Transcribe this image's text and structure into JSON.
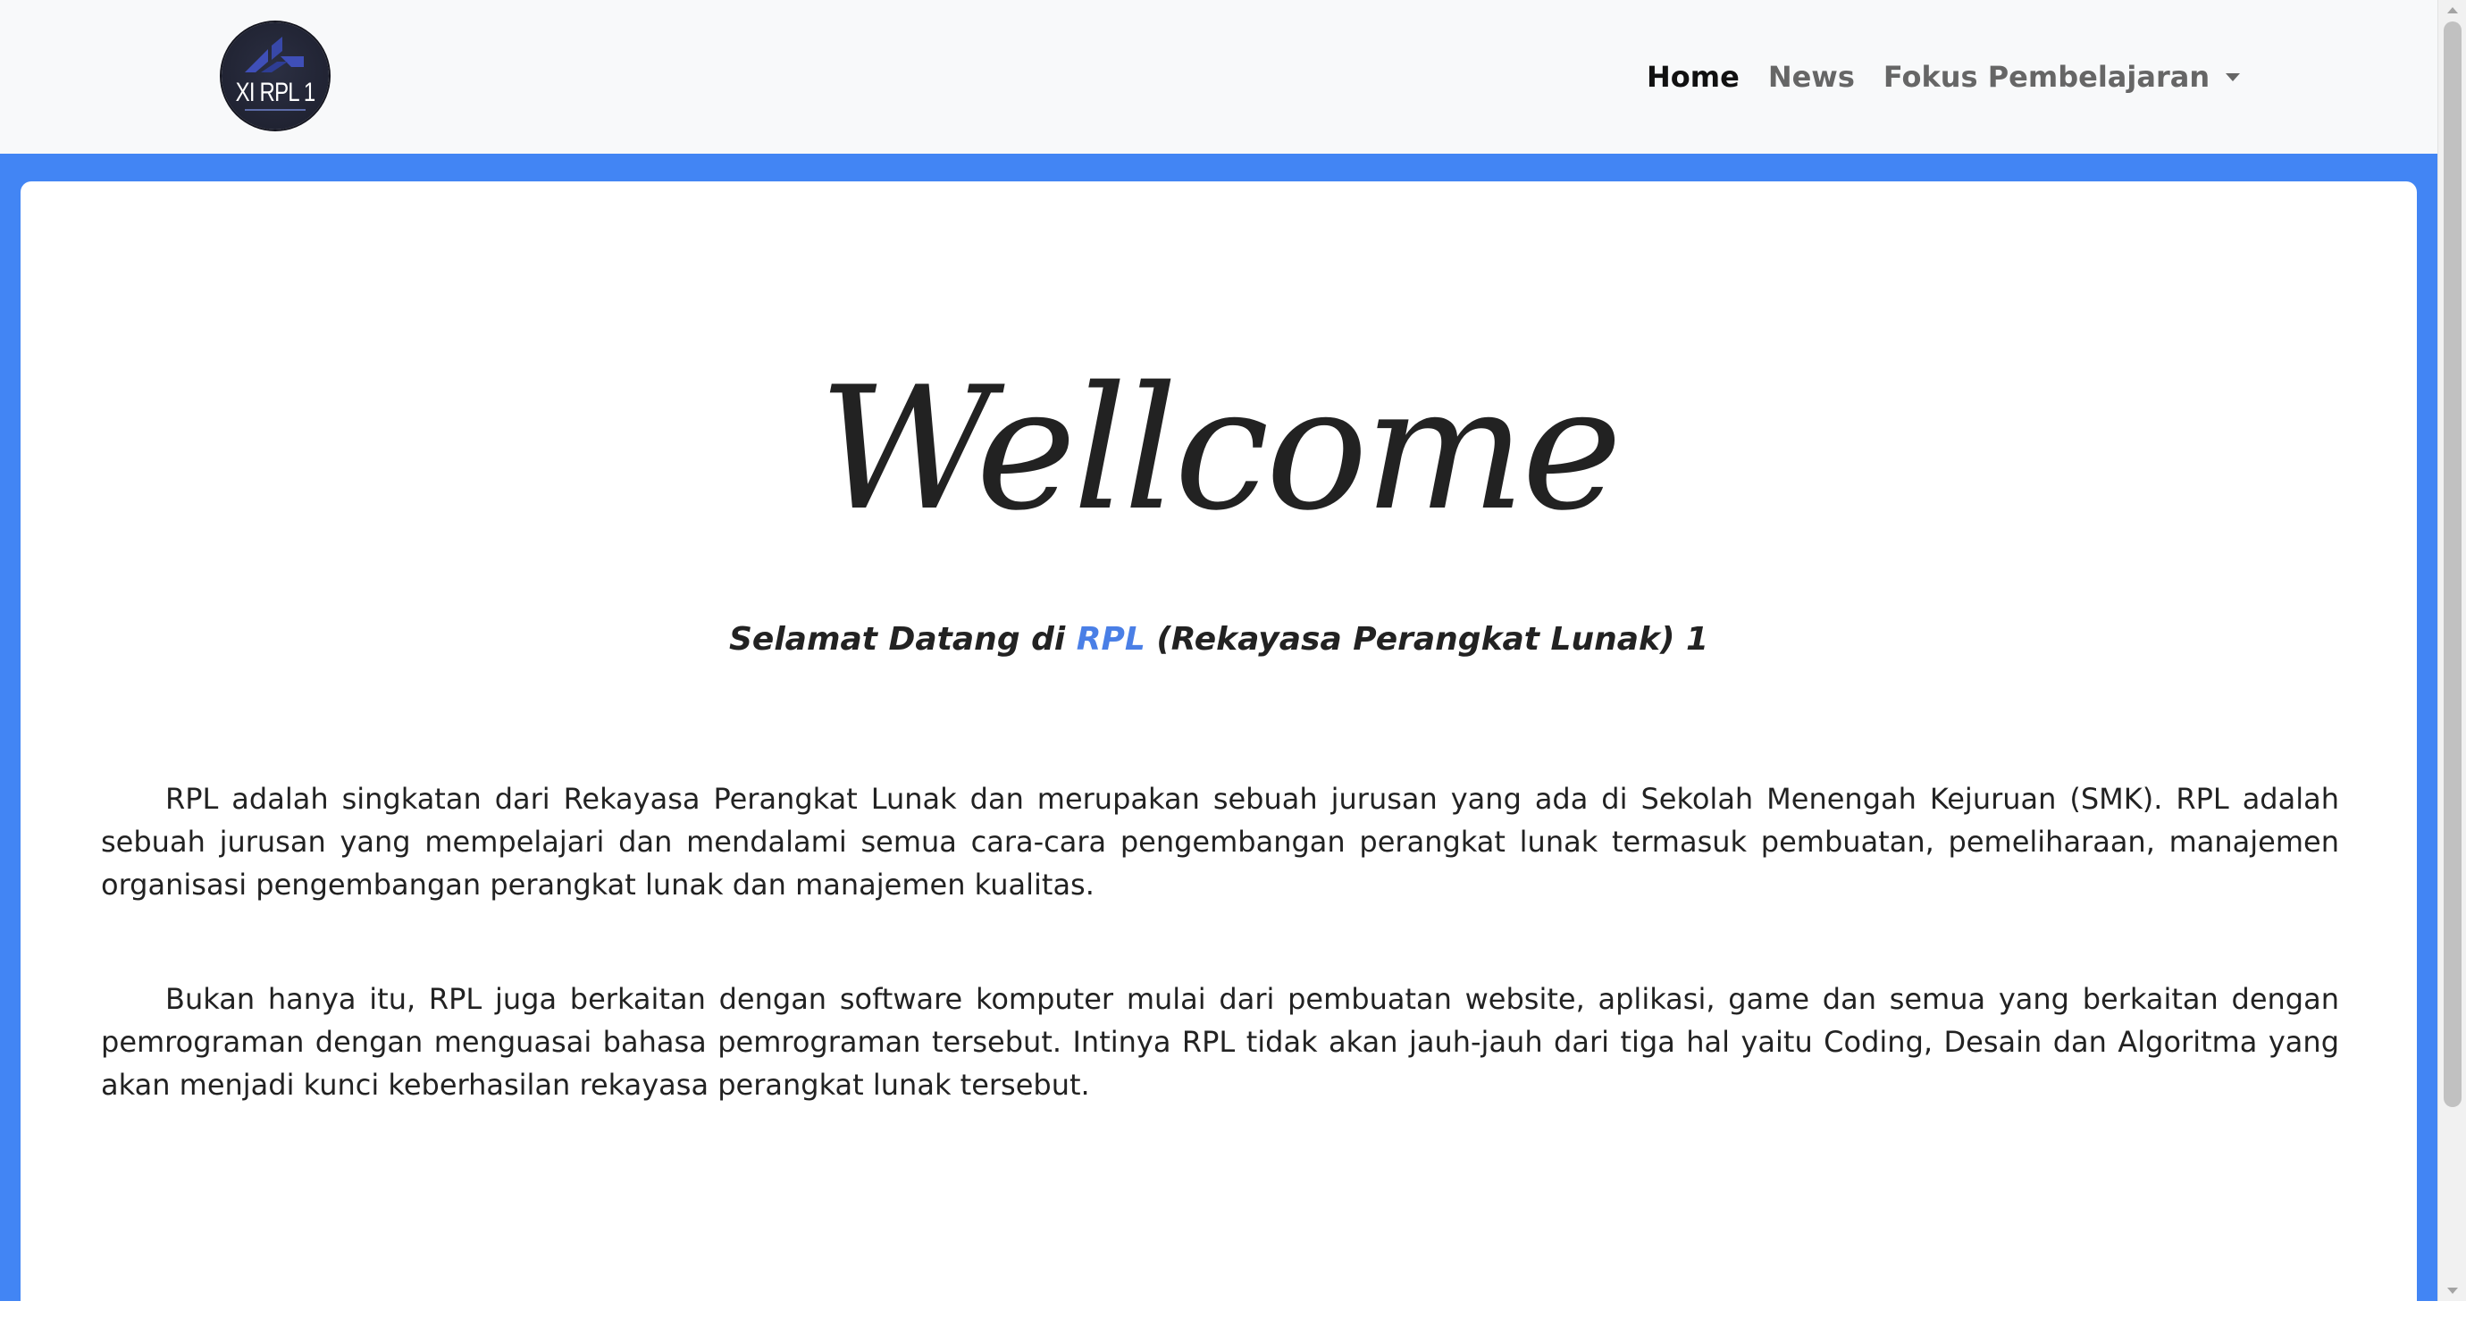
{
  "navbar": {
    "logo_text": "XI RPL 1",
    "links": [
      {
        "label": "Home",
        "active": true
      },
      {
        "label": "News",
        "active": false
      }
    ],
    "dropdown_label": "Fokus Pembelajaran"
  },
  "hero": {
    "title": "Wellcome",
    "subtitle_prefix": "Selamat Datang di ",
    "subtitle_accent": "RPL",
    "subtitle_suffix": " (Rekayasa Perangkat Lunak) 1"
  },
  "content": {
    "paragraph1": "RPL adalah singkatan dari Rekayasa Perangkat Lunak dan merupakan sebuah jurusan yang ada di Sekolah Menengah Kejuruan (SMK). RPL adalah sebuah jurusan yang mempelajari dan mendalami semua cara-cara pengembangan perangkat lunak termasuk pembuatan, pemeliharaan, manajemen organisasi pengembangan perangkat lunak dan manajemen kualitas.",
    "paragraph2": "Bukan hanya itu, RPL juga berkaitan dengan software komputer mulai dari pembuatan website, aplikasi, game dan semua yang berkaitan dengan pemrograman dengan menguasai bahasa pemrograman tersebut. Intinya RPL tidak akan jauh-jauh dari tiga hal yaitu Coding, Desain dan Algoritma yang akan menjadi kunci keberhasilan rekayasa perangkat lunak tersebut."
  },
  "colors": {
    "band": "#4285f4",
    "accent": "#4a7fe6",
    "navbar_bg": "#f8f9fa"
  }
}
